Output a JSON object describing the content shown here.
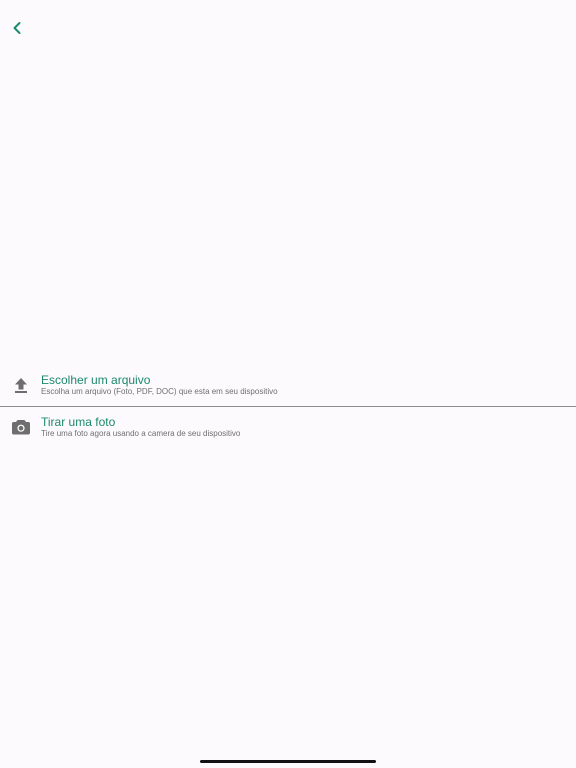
{
  "header": {
    "back_icon": "chevron-left-icon"
  },
  "options": [
    {
      "icon": "upload-icon",
      "title": "Escolher um arquivo",
      "subtitle": "Escolha um arquivo (Foto, PDF, DOC) que esta em seu dispositivo"
    },
    {
      "icon": "camera-icon",
      "title": "Tirar uma foto",
      "subtitle": "Tire uma foto agora usando a camera de seu dispositivo"
    }
  ],
  "colors": {
    "accent": "#1c8a6c",
    "background": "#fcfafd",
    "icon": "#6e6e6e",
    "subtitle": "#6f6f6f",
    "divider": "#8c8c8c"
  }
}
